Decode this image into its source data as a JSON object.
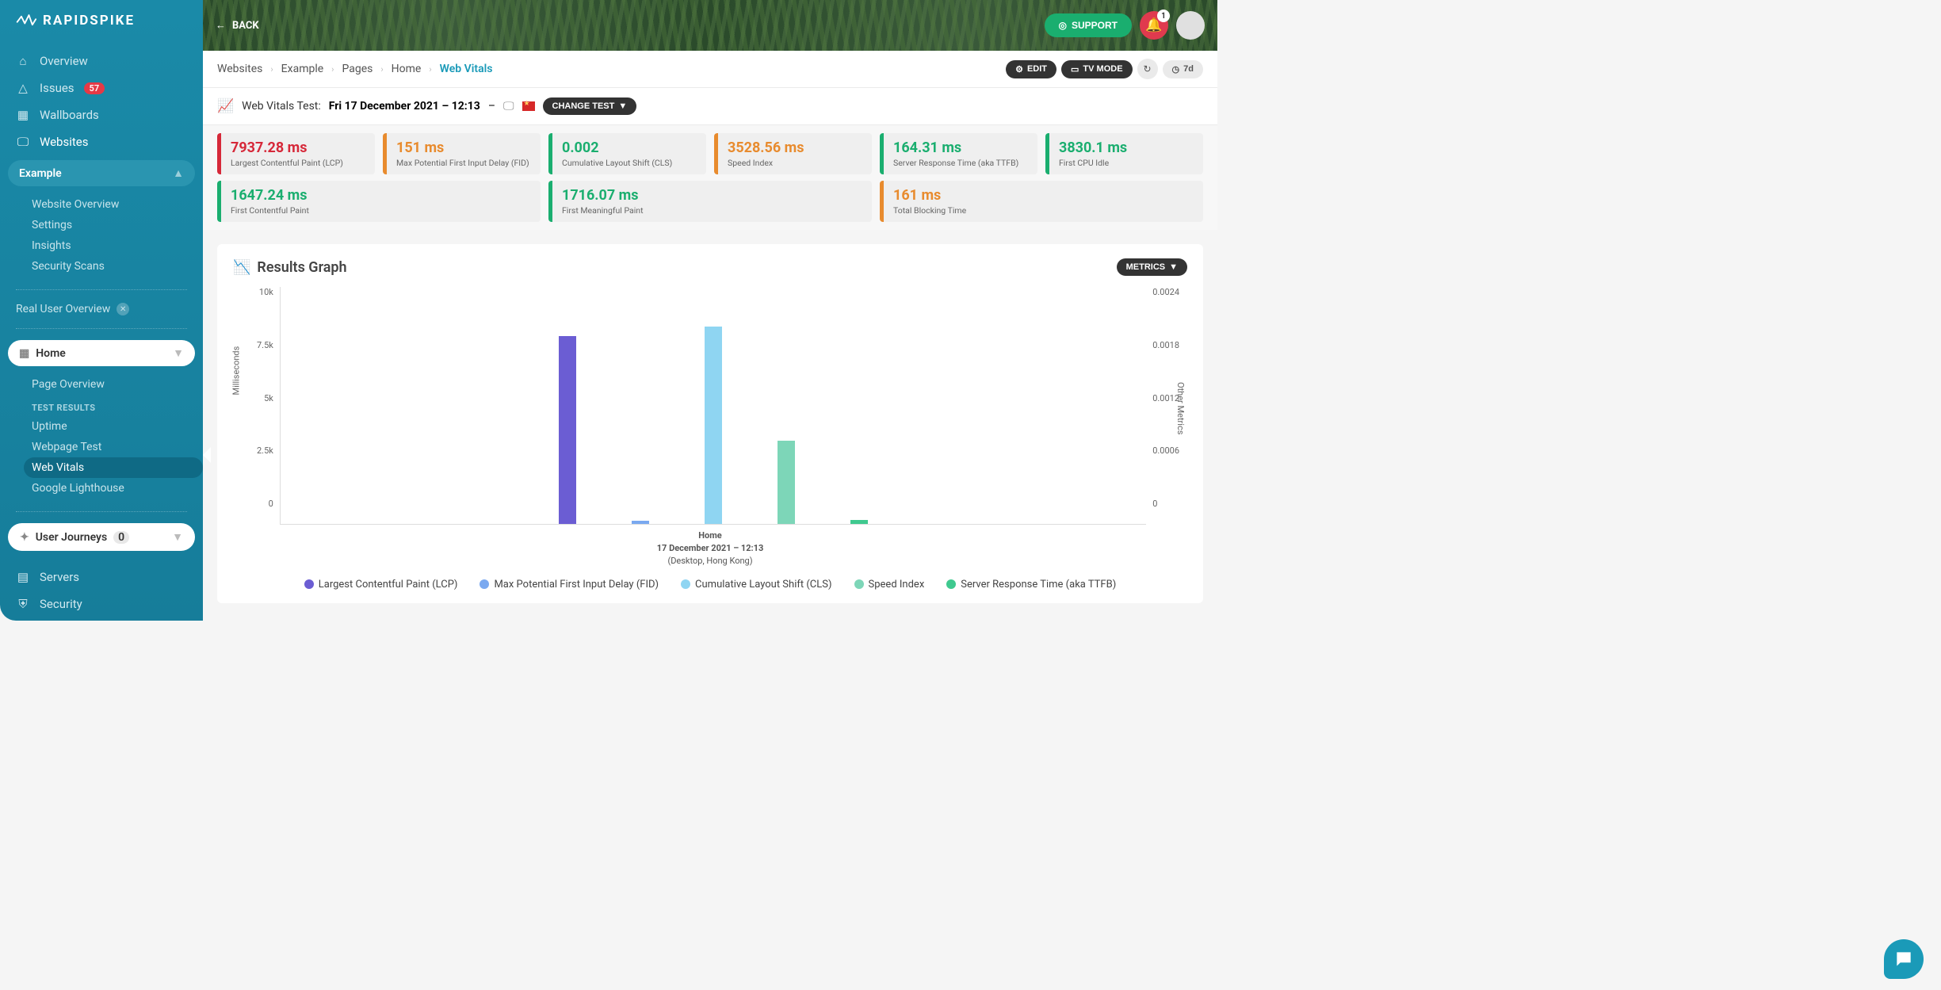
{
  "brand": "RAPIDSPIKE",
  "banner": {
    "back": "BACK",
    "support": "SUPPORT",
    "bell_count": "1"
  },
  "nav": {
    "overview": "Overview",
    "issues": "Issues",
    "issues_count": "57",
    "wallboards": "Wallboards",
    "websites": "Websites",
    "servers": "Servers",
    "security": "Security"
  },
  "sidebar": {
    "site_pill": "Example",
    "sub": {
      "wo": "Website Overview",
      "settings": "Settings",
      "insights": "Insights",
      "scans": "Security Scans"
    },
    "ruo": "Real User Overview",
    "home_pill": "Home",
    "po": "Page Overview",
    "tr_label": "TEST RESULTS",
    "uptime": "Uptime",
    "wpt": "Webpage Test",
    "wv": "Web Vitals",
    "gl": "Google Lighthouse",
    "uj": "User Journeys",
    "uj_count": "0"
  },
  "crumbs": {
    "c1": "Websites",
    "c2": "Example",
    "c3": "Pages",
    "c4": "Home",
    "c5": "Web Vitals"
  },
  "actions": {
    "edit": "EDIT",
    "tv": "TV MODE",
    "range": "7d"
  },
  "test": {
    "prefix": "Web Vitals Test: ",
    "date": "Fri 17 December 2021 – 12:13",
    "suffix": " – ",
    "change": "CHANGE TEST"
  },
  "tiles": [
    {
      "val": "7937.28 ms",
      "lbl": "Largest Contentful Paint (LCP)",
      "c": "red"
    },
    {
      "val": "151 ms",
      "lbl": "Max Potential First Input Delay (FID)",
      "c": "orange"
    },
    {
      "val": "0.002",
      "lbl": "Cumulative Layout Shift (CLS)",
      "c": "green"
    },
    {
      "val": "3528.56 ms",
      "lbl": "Speed Index",
      "c": "orange"
    },
    {
      "val": "164.31 ms",
      "lbl": "Server Response Time (aka TTFB)",
      "c": "green"
    },
    {
      "val": "3830.1 ms",
      "lbl": "First CPU Idle",
      "c": "green"
    },
    {
      "val": "1647.24 ms",
      "lbl": "First Contentful Paint",
      "c": "green"
    },
    {
      "val": "1716.07 ms",
      "lbl": "First Meaningful Paint",
      "c": "green"
    },
    {
      "val": "161 ms",
      "lbl": "Total Blocking Time",
      "c": "orange"
    }
  ],
  "chart": {
    "title": "Results Graph",
    "metrics_btn": "METRICS",
    "y_left": [
      "10k",
      "7.5k",
      "5k",
      "2.5k",
      "0"
    ],
    "y_right": [
      "0.0024",
      "0.0018",
      "0.0012",
      "0.0006",
      "0"
    ],
    "y_label_l": "Milliseconds",
    "y_label_r": "Other Metrics",
    "caption_l1": "Home",
    "caption_l2": "17 December 2021 – 12:13",
    "caption_l3": "(Desktop, Hong Kong)",
    "legend": [
      {
        "label": "Largest Contentful Paint (LCP)",
        "color": "#6b5dd3"
      },
      {
        "label": "Max Potential First Input Delay (FID)",
        "color": "#7aa9f0"
      },
      {
        "label": "Cumulative Layout Shift (CLS)",
        "color": "#8fd5f2"
      },
      {
        "label": "Speed Index",
        "color": "#7dd6b8"
      },
      {
        "label": "Server Response Time (aka TTFB)",
        "color": "#3fc98f"
      }
    ]
  },
  "chart_data": {
    "type": "bar",
    "title": "Results Graph",
    "xlabel": "",
    "ylabel": "Milliseconds",
    "ylim": [
      0,
      10000
    ],
    "ylabel_right": "Other Metrics",
    "ylim_right": [
      0,
      0.0024
    ],
    "x_caption": "Home — 17 December 2021 – 12:13 (Desktop, Hong Kong)",
    "series": [
      {
        "name": "Largest Contentful Paint (LCP)",
        "value": 7937.28,
        "axis": "left",
        "color": "#6b5dd3"
      },
      {
        "name": "Max Potential First Input Delay (FID)",
        "value": 151,
        "axis": "left",
        "color": "#7aa9f0"
      },
      {
        "name": "Cumulative Layout Shift (CLS)",
        "value": 0.002,
        "axis": "right",
        "color": "#8fd5f2"
      },
      {
        "name": "Speed Index",
        "value": 3528.56,
        "axis": "left",
        "color": "#7dd6b8"
      },
      {
        "name": "Server Response Time (aka TTFB)",
        "value": 164.31,
        "axis": "left",
        "color": "#3fc98f"
      }
    ]
  }
}
